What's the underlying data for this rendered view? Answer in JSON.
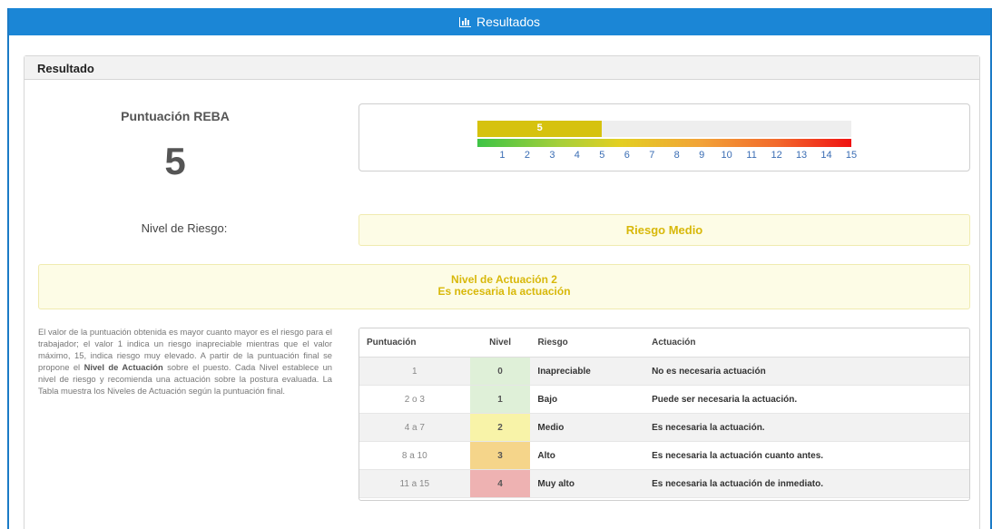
{
  "header": {
    "title": "Resultados",
    "icon": "bar-chart-icon"
  },
  "panel": {
    "title": "Resultado"
  },
  "score": {
    "label": "Puntuación REBA",
    "value": "5"
  },
  "gauge": {
    "fill_label": "5",
    "value": 5,
    "max": 15,
    "fill_color": "#d6c20e",
    "ticks": [
      "1",
      "2",
      "3",
      "4",
      "5",
      "6",
      "7",
      "8",
      "9",
      "10",
      "11",
      "12",
      "13",
      "14",
      "15"
    ]
  },
  "risk": {
    "label": "Nivel de Riesgo:",
    "value": "Riesgo Medio"
  },
  "action": {
    "line1": "Nivel de Actuación 2",
    "line2": "Es necesaria la actuación"
  },
  "description": {
    "part1": "El valor de la puntuación obtenida es mayor cuanto mayor es el riesgo para el trabajador; el valor 1 indica un riesgo inapreciable mientras que el valor máximo, 15, indica riesgo muy elevado. A partir de la puntuación final se propone el ",
    "bold": "Nivel de Actuación",
    "part2": " sobre el puesto. Cada Nivel establece un nivel de riesgo y recomienda una actuación sobre la postura evaluada. La Tabla muestra los Niveles de Actuación según la puntuación final."
  },
  "table": {
    "headers": {
      "score": "Puntuación",
      "level": "Nivel",
      "risk": "Riesgo",
      "action": "Actuación"
    },
    "rows": [
      {
        "score": "1",
        "level": "0",
        "risk": "Inapreciable",
        "action": "No es necesaria actuación",
        "row_bg": "#f2f2f2",
        "level_bg": "#dff0d8"
      },
      {
        "score": "2 o 3",
        "level": "1",
        "risk": "Bajo",
        "action": "Puede ser necesaria la actuación.",
        "row_bg": "#ffffff",
        "level_bg": "#dff0d8"
      },
      {
        "score": "4 a 7",
        "level": "2",
        "risk": "Medio",
        "action": "Es necesaria la actuación.",
        "row_bg": "#f2f2f2",
        "level_bg": "#f8f3a8"
      },
      {
        "score": "8 a 10",
        "level": "3",
        "risk": "Alto",
        "action": "Es necesaria la actuación cuanto antes.",
        "row_bg": "#ffffff",
        "level_bg": "#f5d58a"
      },
      {
        "score": "11 a 15",
        "level": "4",
        "risk": "Muy alto",
        "action": "Es necesaria la actuación de inmediato.",
        "row_bg": "#f2f2f2",
        "level_bg": "#eeb2b2"
      }
    ]
  }
}
